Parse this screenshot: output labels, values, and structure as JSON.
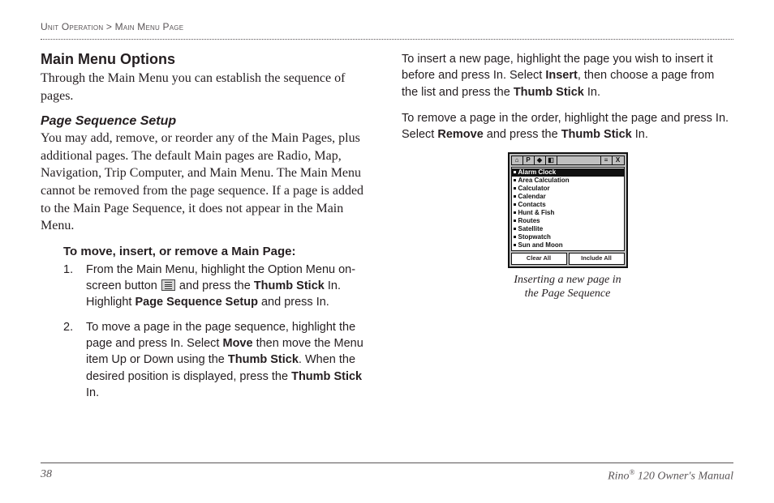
{
  "breadcrumb": {
    "section": "Unit Operation",
    "sep": ">",
    "page": "Main Menu Page"
  },
  "left": {
    "h2": "Main Menu Options",
    "intro": "Through the Main Menu you can establish the sequence of pages.",
    "h3": "Page Sequence Setup",
    "para1": "You may add, remove, or reorder any of the Main Pages, plus additional pages. The default Main pages are Radio, Map, Navigation, Trip Computer, and Main Menu. The Main Menu cannot be removed from the page sequence. If a page is added to the Main Page Sequence, it does not appear in the Main Menu.",
    "h4": "To move, insert, or remove a Main Page:",
    "steps": [
      {
        "num": "1.",
        "seg1": "From the Main Menu, highlight the Option Menu on-screen button ",
        "seg2": " and press the ",
        "b1": "Thumb Stick",
        "seg3": " In. Highlight ",
        "b2": "Page Sequence Setup",
        "seg4": " and press In."
      },
      {
        "num": "2.",
        "seg1": "To move a page in the page sequence, highlight the page and press In. Select ",
        "b1": "Move",
        "seg2": " then move the Menu item Up or Down using the ",
        "b2": "Thumb Stick",
        "seg3": ". When the desired position is displayed, press the ",
        "b3": "Thumb Stick",
        "seg4": " In."
      }
    ]
  },
  "right": {
    "p1": {
      "a": "To insert a new page, highlight the page you wish to insert it before and press In. Select ",
      "b1": "Insert",
      "b": ", then choose a page from the list and press the ",
      "b2": "Thumb Stick",
      "c": " In."
    },
    "p2": {
      "a": "To remove a page in the order, highlight the page and press In. Select ",
      "b1": "Remove",
      "b": " and press the ",
      "b2": "Thumb Stick",
      "c": " In."
    },
    "device": {
      "items": [
        "Alarm Clock",
        "Area Calculation",
        "Calculator",
        "Calendar",
        "Contacts",
        "Hunt & Fish",
        "Routes",
        "Satellite",
        "Stopwatch",
        "Sun and Moon"
      ],
      "clear": "Clear All",
      "include": "Include All"
    },
    "caption_l1": "Inserting a new page in",
    "caption_l2": "the Page Sequence"
  },
  "footer": {
    "pagenum": "38",
    "product_a": "Rino",
    "product_reg": "®",
    "product_b": " 120 Owner's Manual"
  }
}
